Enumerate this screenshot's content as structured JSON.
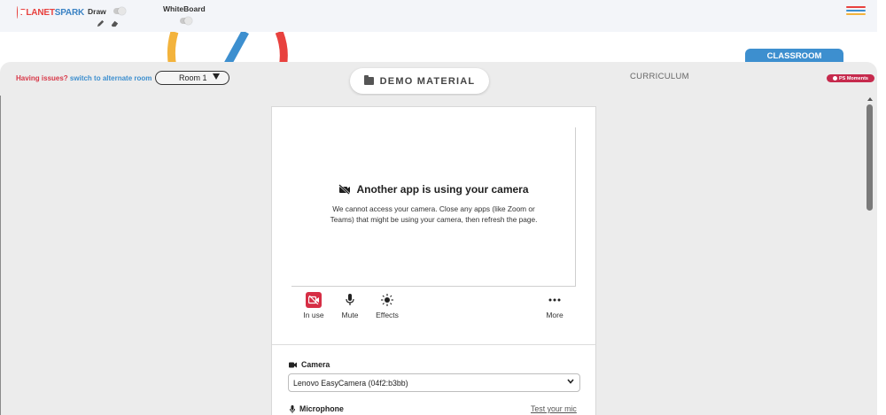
{
  "header": {
    "logo": "PLANETSPARK",
    "draw_label": "Draw",
    "whiteboard_label": "WhiteBoard",
    "menu_colors": [
      "#e8413e",
      "#3d8fcf",
      "#f3b33c"
    ]
  },
  "tabs": {
    "classroom": "CLASSROOM",
    "demo_material": "DEMO MATERIAL",
    "curriculum": "CURRICULUM",
    "ps_moments": "PS Moments"
  },
  "issues": {
    "question": "Having issues?",
    "link": "switch to alternate room"
  },
  "room_select": {
    "value": "Room 1"
  },
  "camera_panel": {
    "title": "Another app is using your camera",
    "message": "We cannot access your camera. Close any apps (like Zoom or Teams) that might be using your camera, then refresh the page.",
    "controls": {
      "in_use": "In use",
      "mute": "Mute",
      "effects": "Effects",
      "more": "More"
    },
    "camera_label": "Camera",
    "camera_value": "Lenovo EasyCamera (04f2:b3bb)",
    "microphone_label": "Microphone",
    "test_mic": "Test your mic"
  },
  "colors": {
    "brand_red": "#e8413e",
    "brand_blue": "#3d8fcf",
    "alert_red": "#d62e45",
    "moments_red": "#c62a4d"
  }
}
